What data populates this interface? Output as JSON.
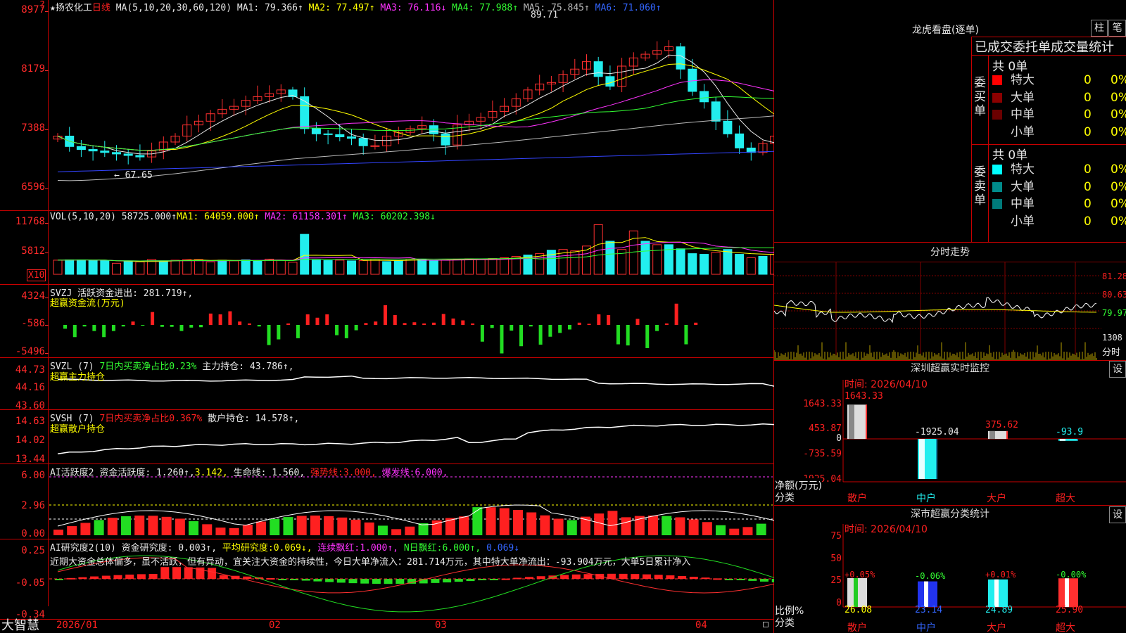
{
  "header": {
    "star": "★",
    "stock_name": "扬农化工",
    "period": "日线",
    "ma_params": "MA(5,10,20,30,60,120)",
    "ma1": "MA1: 79.366↑",
    "ma2": "MA2: 77.497↑",
    "ma3": "MA3: 76.116↓",
    "ma4": "MA4: 77.988↑",
    "ma5": "MA5: 75.845↑",
    "ma6": "MA6: 71.060↑",
    "question": "?"
  },
  "kline": {
    "y_labels": [
      "8977",
      "8179",
      "7388",
      "6596"
    ],
    "high_label": "89.71",
    "low_label": "← 67.65",
    "closes": [
      73.0,
      71.6,
      71.2,
      71.0,
      70.8,
      70.6,
      70.4,
      70.2,
      71.0,
      72.2,
      73.0,
      74.5,
      75.0,
      76.0,
      76.6,
      77.0,
      77.8,
      78.3,
      78.7,
      79.2,
      78.3,
      74.0,
      73.3,
      73.2,
      72.9,
      72.7,
      71.7,
      71.7,
      73.0,
      73.5,
      74.0,
      74.4,
      73.3,
      71.8,
      74.5,
      75.0,
      75.5,
      76.3,
      77.0,
      78.0,
      79.2,
      80.0,
      80.2,
      81.3,
      82.0,
      83.0,
      81.0,
      79.7,
      82.4,
      83.5,
      84.0,
      84.5,
      85.0,
      82.0,
      79.0,
      77.6,
      75.0,
      73.3,
      71.4,
      70.8,
      72.0,
      73.0,
      73.6,
      74.5,
      75.6,
      76.0,
      75.5,
      75.9,
      74.6,
      75.6,
      78.0,
      79.7,
      79.0
    ]
  },
  "volume": {
    "title": "VOL(5,10,20)",
    "value": "58725.000↑",
    "ma1": "MA1: 64059.000↑",
    "ma2": "MA2: 61158.301↑",
    "ma3": "MA3: 60202.398↓",
    "y_labels": [
      "11768",
      "5812"
    ],
    "unit": "X10",
    "bars": [
      4.1,
      4.2,
      4.2,
      4.1,
      4.0,
      3.2,
      3.7,
      3.6,
      4.3,
      3.8,
      4.1,
      4.3,
      4.3,
      3.6,
      4.1,
      3.9,
      4.2,
      4.0,
      4.4,
      4.1,
      3.5,
      11.6,
      4.1,
      4.0,
      4.1,
      3.9,
      4.0,
      4.4,
      3.7,
      3.9,
      4.4,
      4.4,
      4.0,
      4.1,
      4.4,
      4.5,
      4.4,
      4.6,
      4.8,
      5.2,
      5.6,
      6.0,
      7.0,
      7.2,
      6.8,
      8.2,
      14.4,
      9.6,
      7.2,
      12.6,
      9.6,
      8.6,
      8.6,
      7.4,
      6.0,
      5.8,
      6.4,
      7.2,
      5.8,
      4.8,
      5.2,
      5.8,
      5.6,
      6.0,
      5.6,
      5.2,
      4.6,
      5.0,
      7.0,
      8.6,
      6.4,
      6.0,
      6.2
    ],
    "colors": [
      "r",
      "c",
      "c",
      "c",
      "c",
      "r",
      "c",
      "r",
      "r",
      "c",
      "r",
      "r",
      "r",
      "r",
      "c",
      "r",
      "c",
      "c",
      "r",
      "r",
      "r",
      "c",
      "c",
      "c",
      "r",
      "c",
      "r",
      "r",
      "c",
      "c",
      "r",
      "c",
      "c",
      "r",
      "r",
      "r",
      "r",
      "r",
      "r",
      "r",
      "c",
      "r",
      "c",
      "r",
      "r",
      "r",
      "r",
      "c",
      "r",
      "r",
      "c",
      "r",
      "c",
      "c",
      "c",
      "c",
      "r",
      "c",
      "c",
      "r",
      "c",
      "r",
      "r",
      "c",
      "r",
      "r",
      "c",
      "c",
      "c",
      "r",
      "r",
      "c",
      "c"
    ]
  },
  "svzj": {
    "title": "SVZJ",
    "label1": "活跃资金进出:",
    "value1": "281.719↑,",
    "label2": "超赢资金流(万元)",
    "y_labels": [
      "4324",
      "-586",
      "-5496"
    ],
    "values": [
      -1.0,
      -3.2,
      -0.4,
      -1.6,
      -3.2,
      -1.6,
      -0.4,
      0.9,
      -0.2,
      3.4,
      -0.5,
      -0.5,
      -1.6,
      -0.7,
      -0.6,
      3.0,
      2.8,
      3.6,
      0.9,
      0.4,
      -0.4,
      -5.3,
      -3.8,
      0.4,
      -3.5,
      2.8,
      1.9,
      2.8,
      -2.7,
      -3.5,
      -1.4,
      0.5,
      0.9,
      5.2,
      2.6,
      0.5,
      0.7,
      0.4,
      0.6,
      2.9,
      1.7,
      1.2,
      0.4,
      -4.4,
      -0.8,
      -7.5,
      -1.5,
      -5.6,
      -0.4,
      -5.2,
      -3.1,
      -2.1,
      -1.2,
      0.6,
      0.3,
      2.8,
      2.6,
      -5.1,
      -5.4,
      1.6,
      -6.1,
      -1.6,
      0.4,
      5.6,
      -5.1,
      0.6
    ]
  },
  "svzl": {
    "title": "SVZL (7)",
    "label1": "7日内买卖净占比0.23%",
    "label2": "主力持仓:",
    "value2": "43.786↑,",
    "label3": "超赢主力持仓",
    "y_labels": [
      "44.73",
      "44.16",
      "43.60"
    ]
  },
  "svsh": {
    "title": "SVSH (7)",
    "label1": "7日内买卖净占比0.367%",
    "label2": "散户持仓:",
    "value2": "14.578↑,",
    "label3": "超赢散户持仓",
    "y_labels": [
      "14.63",
      "14.02",
      "13.44"
    ]
  },
  "ai1": {
    "title": "AI活跃度2",
    "label1": "资金活跃度:",
    "value1": "1.260↑,",
    "value2": "3.142,",
    "label3": "生命线:",
    "value3": "1.560,",
    "label4": "强势线:",
    "value4": "3.000,",
    "label5": "爆发线:",
    "value5": "6.000,",
    "y_labels": [
      "6.00",
      "2.96",
      "0.00"
    ]
  },
  "ai2": {
    "title": "AI研究度2(10)",
    "label1": "资金研究度:",
    "value1": "0.003↑,",
    "label2": "平均研究度:",
    "value2": "0.069↓,",
    "label3": "连续飘红:",
    "value3": "1.000↑,",
    "label4": "N日飘红:",
    "value4": "6.000↑,",
    "value5": "0.069↓",
    "comment": "近期大资金总体偏多，虽不活跃，但有异动，宜关注大资金的持续性，今日大单净流入：281.714万元，其中特大单净流出：-93.904万元，大单5日累计净入",
    "y_labels": [
      "0.25",
      "-0.05",
      "-0.34"
    ]
  },
  "bottom_bar": {
    "app_name": "大智慧",
    "dates": [
      "2026/01",
      "02",
      "03",
      "04"
    ]
  },
  "right": {
    "top_title": "龙虎看盘(逐单)",
    "btn_bar": "柱",
    "btn_pen": "笔",
    "subtitle": "已成交委托单成交量统计",
    "buy_label": "委买单",
    "sell_label": "委卖单",
    "buy_total": "共 0单",
    "sell_total": "共 0单",
    "buy_rows": [
      {
        "name": "特大",
        "count": "0",
        "pct": "0%",
        "color": "#ff0000"
      },
      {
        "name": "大单",
        "count": "0",
        "pct": "0%",
        "color": "#8b0000"
      },
      {
        "name": "中单",
        "count": "0",
        "pct": "0%",
        "color": "#6b0000"
      },
      {
        "name": "小单",
        "count": "0",
        "pct": "0%",
        "color": ""
      }
    ],
    "sell_rows": [
      {
        "name": "特大",
        "count": "0",
        "pct": "0%",
        "color": "#00ffff"
      },
      {
        "name": "大单",
        "count": "0",
        "pct": "0%",
        "color": "#008b8b"
      },
      {
        "name": "中单",
        "count": "0",
        "pct": "0%",
        "color": "#007a7a"
      },
      {
        "name": "小单",
        "count": "0",
        "pct": "0%",
        "color": ""
      }
    ],
    "intraday_title": "分时走势",
    "intraday_labels": [
      "81.28",
      "80.63",
      "79.97",
      "1308",
      "分时"
    ],
    "monitor_title": "深圳超赢实时监控",
    "monitor_btn": "设",
    "monitor_time": "时间: 2026/04/10",
    "monitor_y": [
      "1643.33",
      "453.87",
      "0",
      "-735.59",
      "-1925.04"
    ],
    "monitor_axis": "净额(万元)",
    "monitor_axis2": "分类",
    "monitor_cats": [
      "散户",
      "中户",
      "大户",
      "超大"
    ],
    "monitor_vals": [
      "1643.33",
      "-1925.04",
      "375.62",
      "-93.9"
    ],
    "monitor_values": [
      1643.33,
      -1925.04,
      375.62,
      -93.9
    ],
    "stat_title": "深市超赢分类统计",
    "stat_btn": "设",
    "stat_time": "时间: 2026/04/10",
    "stat_y": [
      "75",
      "50",
      "25",
      "0"
    ],
    "stat_axis": "比例%",
    "stat_axis2": "分类",
    "stat_changes": [
      "+0.05%",
      "-0.06%",
      "+0.01%",
      "-0.00%"
    ],
    "stat_values": [
      "26.08",
      "23.14",
      "24.89",
      "25.90"
    ],
    "stat_numbers": [
      26.08,
      23.14,
      24.89,
      25.9
    ],
    "stat_cats": [
      "散户",
      "中户",
      "大户",
      "超大"
    ]
  }
}
